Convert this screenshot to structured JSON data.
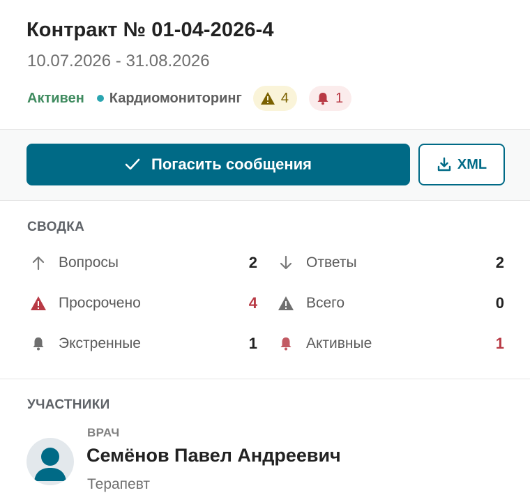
{
  "contract": {
    "title": "Контракт № 01-04-2026-4",
    "dates": "10.07.2026 - 31.08.2026",
    "status": "Активен",
    "program": "Кардиомониторинг",
    "warning_count": "4",
    "alert_count": "1"
  },
  "actions": {
    "primary_label": "Погасить сообщения",
    "xml_label": "XML"
  },
  "summary": {
    "title": "СВОДКА",
    "items": [
      {
        "label": "Вопросы",
        "value": "2",
        "icon": "arrow-up-icon"
      },
      {
        "label": "Ответы",
        "value": "2",
        "icon": "arrow-down-icon"
      },
      {
        "label": "Просрочено",
        "value": "4",
        "icon": "warning-icon"
      },
      {
        "label": "Всего",
        "value": "0",
        "icon": "warning-icon"
      },
      {
        "label": "Экстренные",
        "value": "1",
        "icon": "bell-icon"
      },
      {
        "label": "Активные",
        "value": "1",
        "icon": "bell-icon"
      }
    ]
  },
  "participants": {
    "title": "УЧАСТНИКИ",
    "doctor": {
      "role": "ВРАЧ",
      "name": "Семёнов Павел Андреевич",
      "specialty": "Терапевт"
    }
  },
  "colors": {
    "accent": "#006a86",
    "active_green": "#3f8b5f",
    "alert_red": "#b83a45",
    "warn_yellow": "#7a6100",
    "dot": "#2aa5b0"
  }
}
